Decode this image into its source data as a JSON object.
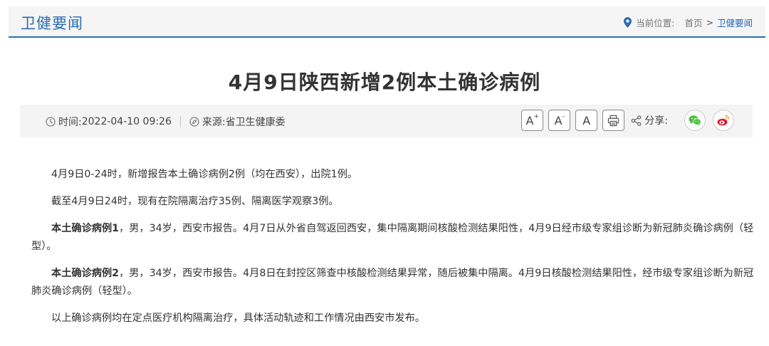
{
  "header": {
    "section_title": "卫健要闻",
    "breadcrumb": {
      "label": "当前位置:",
      "home": "首页",
      "separator": ">",
      "current": "卫健要闻"
    }
  },
  "article": {
    "title": "4月9日陕西新增2例本土确诊病例",
    "meta": {
      "time_label": "时间:",
      "time_value": "2022-04-10 09:26",
      "source_label": "来源:",
      "source_value": "省卫生健康委"
    },
    "toolbar": {
      "font_increase": "A",
      "font_increase_sup": "+",
      "font_decrease": "A",
      "font_decrease_sup": "-",
      "font_reset": "A",
      "share_label": "分享:"
    },
    "paragraphs": {
      "p1": "4月9日0-24时，新增报告本土确诊病例2例（均在西安），出院1例。",
      "p2": "截至4月9日24时，现有在院隔离治疗35例、隔离医学观察3例。",
      "p3_bold": "本土确诊病例1",
      "p3_rest": "，男，34岁，西安市报告。4月7日从外省自驾返回西安，集中隔离期间核酸检测结果阳性，4月9日经市级专家组诊断为新冠肺炎确诊病例（轻型）。",
      "p4_bold": "本土确诊病例2",
      "p4_rest": "，男，34岁，西安市报告。4月8日在封控区筛查中核酸检测结果异常，随后被集中隔离。4月9日核酸检测结果阳性，经市级专家组诊断为新冠肺炎确诊病例（轻型）。",
      "p5": "以上确诊病例均在定点医疗机构隔离治疗，具体活动轨迹和工作情况由西安市发布。"
    }
  },
  "colors": {
    "accent": "#2b6cb0",
    "wechat": "#4cbf3c",
    "weibo": "#e6162d"
  },
  "icons": [
    "location-pin-icon",
    "clock-icon",
    "compass-icon",
    "printer-icon",
    "share-icon",
    "wechat-icon",
    "weibo-icon"
  ]
}
